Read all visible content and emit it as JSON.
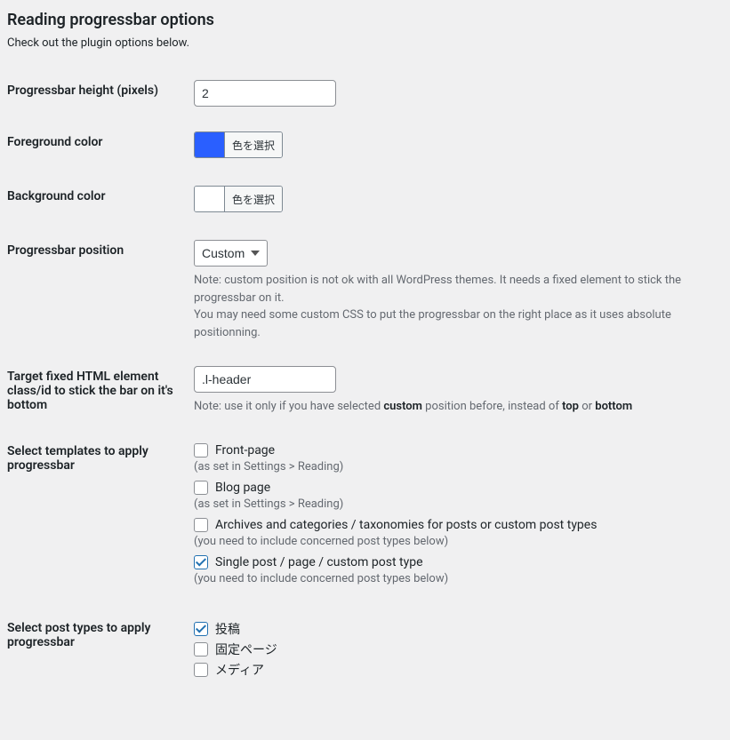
{
  "heading": "Reading progressbar options",
  "subtitle": "Check out the plugin options below.",
  "rows": {
    "height": {
      "label": "Progressbar height (pixels)",
      "value": "2"
    },
    "fg": {
      "label": "Foreground color",
      "button": "色を選択",
      "color": "#2a5fff"
    },
    "bg": {
      "label": "Background color",
      "button": "色を選択",
      "color": "#ffffff"
    },
    "position": {
      "label": "Progressbar position",
      "value": "Custom",
      "note1": "Note: custom position is not ok with all WordPress themes. It needs a fixed element to stick the progressbar on it.",
      "note2": "You may need some custom CSS to put the progressbar on the right place as it uses absolute positionning."
    },
    "target": {
      "label": "Target fixed HTML element class/id to stick the bar on it's bottom",
      "value": ".l-header",
      "note_pre": "Note: use it only if you have selected ",
      "note_custom": "custom",
      "note_mid": " position before, instead of ",
      "note_top": "top",
      "note_or": " or ",
      "note_bottom": "bottom"
    },
    "templates": {
      "label": "Select templates to apply progressbar",
      "opts": [
        {
          "label": "Front-page",
          "hint": "(as set in Settings > Reading)",
          "checked": false
        },
        {
          "label": "Blog page",
          "hint": "(as set in Settings > Reading)",
          "checked": false
        },
        {
          "label": "Archives and categories / taxonomies for posts or custom post types",
          "hint": "(you need to include concerned post types below)",
          "checked": false
        },
        {
          "label": "Single post / page / custom post type",
          "hint": "(you need to include concerned post types below)",
          "checked": true
        }
      ]
    },
    "posttypes": {
      "label": "Select post types to apply progressbar",
      "opts": [
        {
          "label": "投稿",
          "checked": true
        },
        {
          "label": "固定ページ",
          "checked": false
        },
        {
          "label": "メディア",
          "checked": false
        }
      ]
    }
  }
}
